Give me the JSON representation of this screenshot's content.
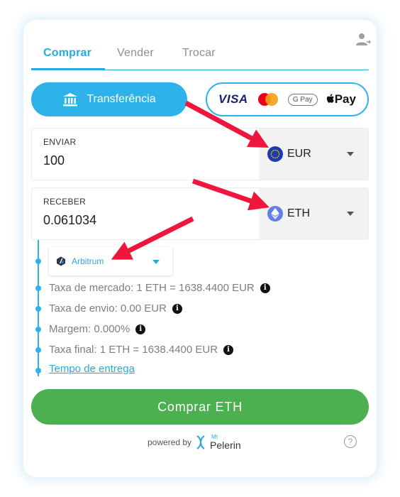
{
  "tabs": [
    {
      "label": "Comprar"
    },
    {
      "label": "Vender"
    },
    {
      "label": "Trocar"
    }
  ],
  "payment": {
    "transfer_label": "Transferência",
    "visa_label": "VISA",
    "gpay_label": "G Pay",
    "apay_label": "Pay"
  },
  "send": {
    "label": "ENVIAR",
    "value": "100",
    "currency": "EUR"
  },
  "receive": {
    "label": "RECEBER",
    "value": "0.061034",
    "currency": "ETH"
  },
  "network": {
    "selected": "Arbitrum"
  },
  "details": {
    "market_rate": "Taxa de mercado: 1 ETH = 1638.4400 EUR",
    "shipping_fee": "Taxa de envio: 0.00 EUR",
    "margin": "Margem: 0.000%",
    "final_rate": "Taxa final: 1 ETH = 1638.4400 EUR",
    "delivery_link": "Tempo de entrega"
  },
  "buy_button_label": "Comprar ETH",
  "footer": {
    "powered_by": "powered by",
    "brand_mt": "Mt",
    "brand_name": "Pelerin",
    "help_symbol": "?"
  },
  "icons": {
    "user": "user-switch-icon",
    "bank": "bank-icon",
    "eur": "eu-flag-icon",
    "eth": "ethereum-icon",
    "arbitrum": "arbitrum-icon",
    "info": "info-icon"
  },
  "colors": {
    "accent": "#2db2ea",
    "buy_button": "#4caf50",
    "annotation_arrow": "#f0153d",
    "eur_badge": "#1c3aa9",
    "eth_badge": "#627eea"
  }
}
